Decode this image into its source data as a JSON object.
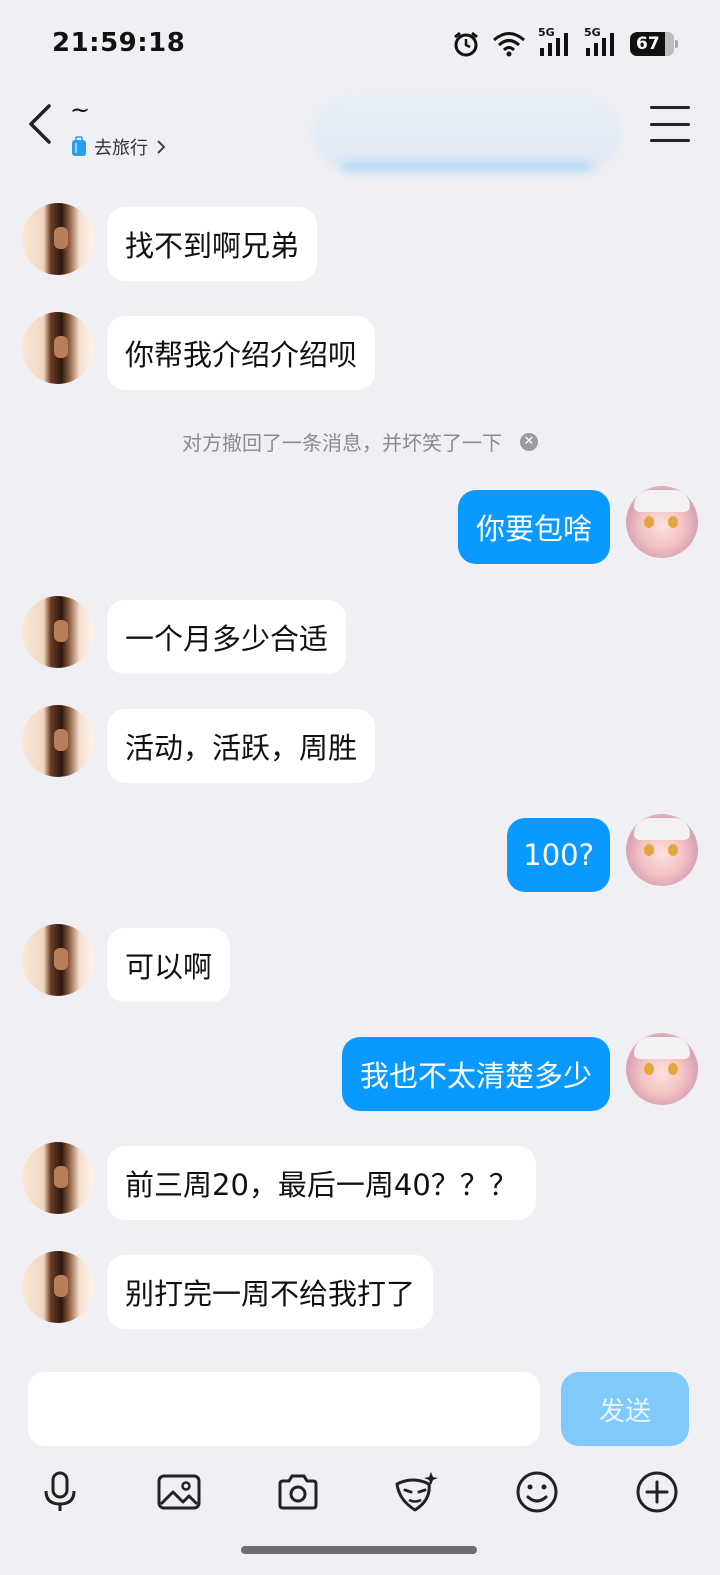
{
  "status_bar": {
    "time": "21:59:18",
    "network_1": "5G",
    "network_2": "5G",
    "battery": "67",
    "icons": [
      "alarm-icon",
      "wifi-icon",
      "signal-5g-icon",
      "signal-5g-icon",
      "battery-icon"
    ]
  },
  "header": {
    "contact_name": "~",
    "status_text": "去旅行",
    "status_icon": "suitcase-icon",
    "back_icon": "chevron-left-icon",
    "menu_icon": "hamburger-menu-icon"
  },
  "colors": {
    "outgoing_bubble": "#0a99ff",
    "incoming_bubble": "#ffffff",
    "background": "#f0f0f4",
    "send_button_disabled": "#80c9fb"
  },
  "messages": [
    {
      "sender": "other",
      "text": "找不到啊兄弟"
    },
    {
      "sender": "other",
      "text": "你帮我介绍介绍呗"
    },
    {
      "sender": "system",
      "text": "对方撤回了一条消息，并坏笑了一下"
    },
    {
      "sender": "self",
      "text": "你要包啥"
    },
    {
      "sender": "other",
      "text": "一个月多少合适"
    },
    {
      "sender": "other",
      "text": "活动，活跃，周胜"
    },
    {
      "sender": "self",
      "text": "100?"
    },
    {
      "sender": "other",
      "text": "可以啊"
    },
    {
      "sender": "self",
      "text": "我也不太清楚多少"
    },
    {
      "sender": "other",
      "text": "前三周20，最后一周40？？？"
    },
    {
      "sender": "other",
      "text": "别打完一周不给我打了"
    }
  ],
  "composer": {
    "input_value": "",
    "send_label": "发送",
    "toolbar_icons": [
      "microphone-icon",
      "image-icon",
      "camera-icon",
      "emoji-sticker-icon",
      "smiley-icon",
      "plus-circle-icon"
    ]
  }
}
